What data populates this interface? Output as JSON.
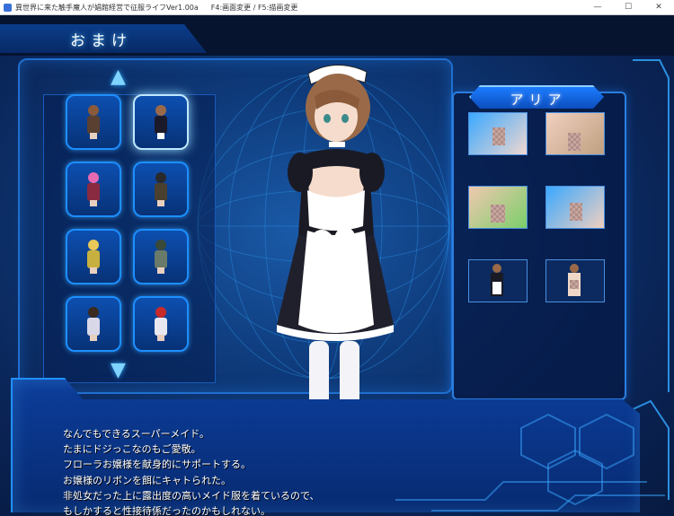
{
  "window": {
    "title": "異世界に来た触手魔人が娼館経営で征服ライフVer1.00a",
    "hint": "F4:画面変更 / F5:描画変更",
    "controls": [
      "—",
      "☐",
      "✕"
    ]
  },
  "screen": {
    "title": "おまけ"
  },
  "characters": {
    "up_arrow": "▲",
    "down_arrow": "▼",
    "slots": [
      {
        "hair": "#8a5a3a",
        "outfit": "#5a4030"
      },
      {
        "hair": "#9a6a48",
        "outfit": "#1a1a2a"
      },
      {
        "hair": "#e86ab0",
        "outfit": "#8a2a40"
      },
      {
        "hair": "#2a2a2a",
        "outfit": "#4a4030"
      },
      {
        "hair": "#e8c858",
        "outfit": "#c8b040"
      },
      {
        "hair": "#3a4a3a",
        "outfit": "#6a7a6a"
      },
      {
        "hair": "#3a2a20",
        "outfit": "#d8d8e8"
      },
      {
        "hair": "#c82a2a",
        "outfit": "#e8e8f0"
      }
    ]
  },
  "selected": {
    "name": "アリア"
  },
  "description": {
    "lines": [
      "なんでもできるスーパーメイド。",
      "たまにドジっこなのもご愛敬。",
      "フローラお嬢様を献身的にサポートする。",
      "お嬢様のリボンを餌にキャトられた。",
      "非処女だった上に露出度の高いメイド服を着ているので、",
      "もしかすると性接待係だったのかもしれない。"
    ]
  },
  "colors": {
    "accent": "#2aa8ff",
    "panel": "#0b3d8a",
    "background": "#0a2456"
  }
}
